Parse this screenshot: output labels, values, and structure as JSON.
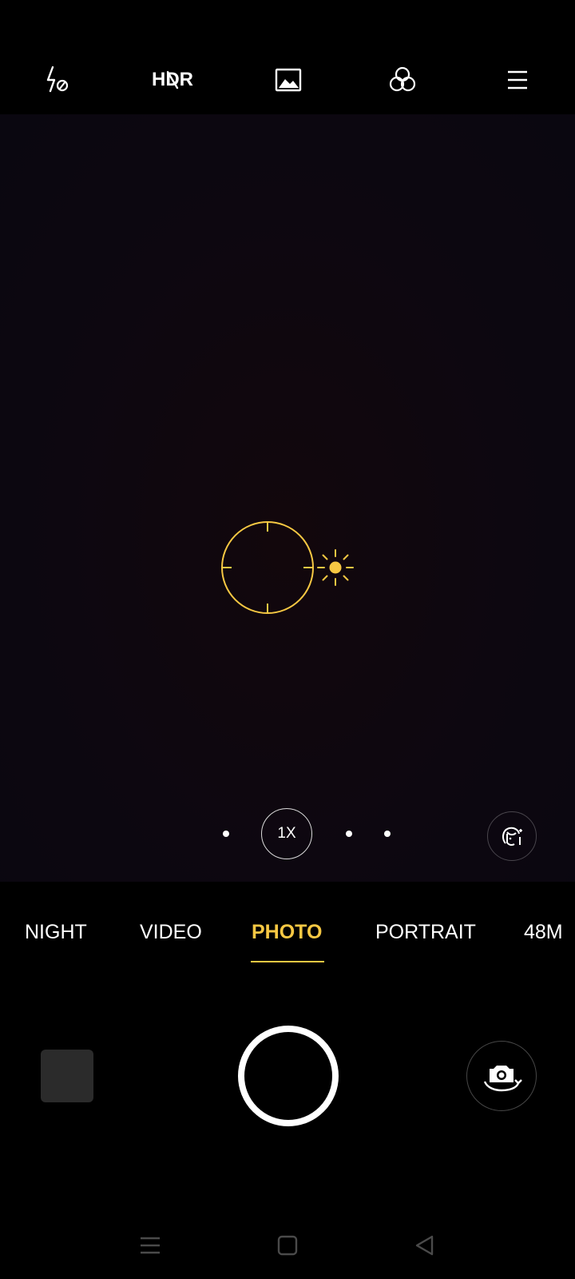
{
  "top_bar": {
    "flash_icon": "flash-off-icon",
    "hdr_label": "HDR",
    "hdr_state": "off",
    "aspect_icon": "image-icon",
    "filter_icon": "filter-icon",
    "menu_icon": "menu-icon"
  },
  "viewfinder": {
    "focus_icon": "focus-ring-icon",
    "exposure_icon": "sun-icon",
    "zoom_label": "1X",
    "beauty_icon": "beauty-face-icon"
  },
  "modes": [
    {
      "label": "NIGHT",
      "active": false
    },
    {
      "label": "VIDEO",
      "active": false
    },
    {
      "label": "PHOTO",
      "active": true
    },
    {
      "label": "PORTRAIT",
      "active": false
    },
    {
      "label": "48M",
      "active": false
    }
  ],
  "bottom_controls": {
    "gallery_icon": "gallery-thumbnail",
    "shutter_icon": "shutter-button",
    "flip_icon": "switch-camera-icon"
  },
  "nav": {
    "recents_icon": "recents-icon",
    "home_icon": "home-icon",
    "back_icon": "back-icon"
  },
  "colors": {
    "accent": "#f7c843",
    "background": "#000000"
  }
}
